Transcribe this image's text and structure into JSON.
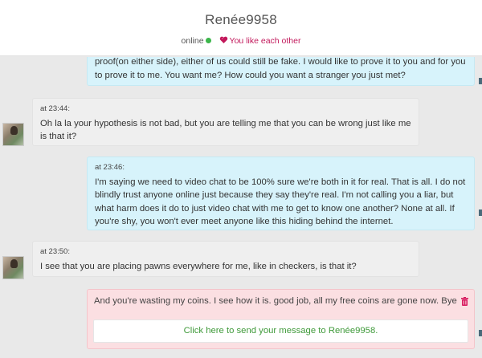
{
  "header": {
    "contact_name": "Renée9958",
    "status": "online",
    "match_text": "You like each other"
  },
  "messages": [
    {
      "direction": "sent",
      "time": "",
      "text": "proof(on either side), either of us could still be fake. I would like to prove it to you and for you to prove it to me. You want me? How could you want a stranger you just met?"
    },
    {
      "direction": "received",
      "time": "at 23:44:",
      "text": "Oh la la your hypothesis is not bad, but you are telling me that you can be wrong just like me is that it?"
    },
    {
      "direction": "sent",
      "time": "at 23:46:",
      "text": "I'm saying we need to video chat to be 100% sure we're both in it for real. That is all. I do not blindly trust anyone online just because they say they're real. I'm not calling you a liar, but what harm does it do to just video chat with me to get to know one another? None at all. If you're shy, you won't ever meet anyone like this hiding behind the internet."
    },
    {
      "direction": "received",
      "time": "at 23:50:",
      "text": "I see that you are placing pawns everywhere for me, like in checkers, is that it?"
    }
  ],
  "paywall": {
    "text": "And you're wasting my coins. I see how it is. good job, all my free coins are gone now. Bye",
    "cta": "Click here to send your message to Renée9958."
  },
  "colors": {
    "sent_bubble": "#d7f3fb",
    "received_bubble": "#efefef",
    "paywall_bg": "#fbdfe2",
    "online": "#3cb64b",
    "match": "#c2185b",
    "cta": "#3f9a3a"
  }
}
